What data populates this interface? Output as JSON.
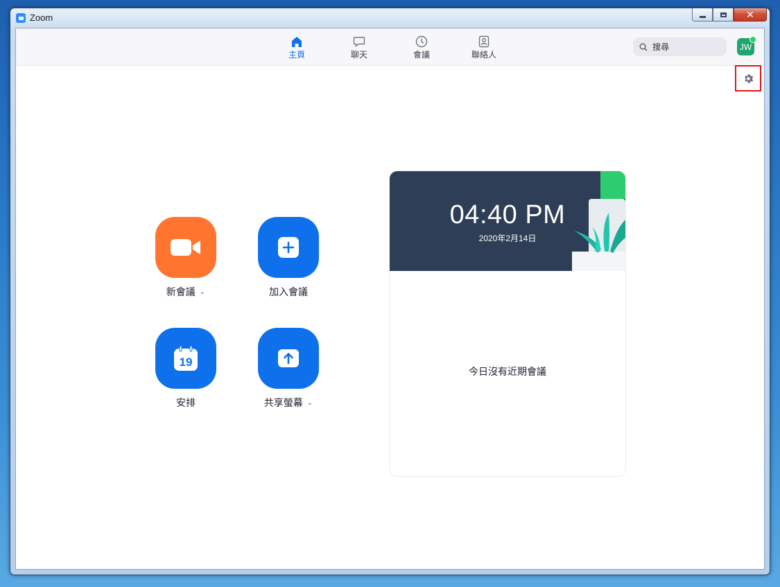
{
  "window": {
    "title": "Zoom"
  },
  "nav": {
    "tabs": [
      {
        "label": "主頁",
        "icon": "home-icon",
        "active": true
      },
      {
        "label": "聊天",
        "icon": "chat-icon",
        "active": false
      },
      {
        "label": "會議",
        "icon": "clock-icon",
        "active": false
      },
      {
        "label": "聯絡人",
        "icon": "contact-icon",
        "active": false
      }
    ],
    "search_placeholder": "搜尋",
    "avatar_initials": "JW",
    "accent_color": "#0e72ed"
  },
  "actions": {
    "new_meeting": "新會議",
    "join_meeting": "加入會議",
    "schedule": "安排",
    "schedule_day": "19",
    "share_screen": "共享螢幕"
  },
  "card": {
    "time": "04:40 PM",
    "date": "2020年2月14日",
    "empty_message": "今日沒有近期會議"
  },
  "colors": {
    "new_meeting_tile": "#ff742e",
    "blue_tile": "#0e71eb",
    "banner": "#2e3e56",
    "highlight_box": "#e01616"
  }
}
